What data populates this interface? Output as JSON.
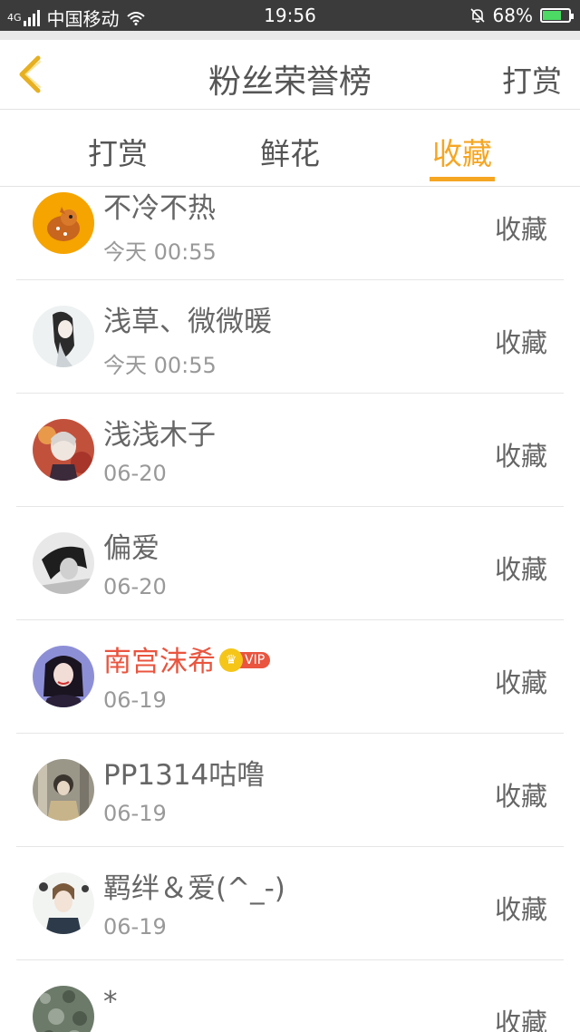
{
  "status_bar": {
    "network": "4G",
    "carrier": "中国移动",
    "time": "19:56",
    "battery": "68%"
  },
  "header": {
    "title": "粉丝荣誉榜",
    "right_action": "打赏"
  },
  "tabs": [
    {
      "label": "打赏",
      "active": false
    },
    {
      "label": "鲜花",
      "active": false
    },
    {
      "label": "收藏",
      "active": true
    }
  ],
  "colors": {
    "accent": "#f5a623",
    "vip_name": "#e9553f",
    "statusbar": "#3b3b3b"
  },
  "list": [
    {
      "name": "不冷不热",
      "time": "今天 00:55",
      "action": "收藏",
      "vip": false
    },
    {
      "name": "浅草、微微暖",
      "time": "今天 00:55",
      "action": "收藏",
      "vip": false
    },
    {
      "name": "浅浅木子",
      "time": "06-20",
      "action": "收藏",
      "vip": false
    },
    {
      "name": "偏爱",
      "time": "06-20",
      "action": "收藏",
      "vip": false
    },
    {
      "name": "南宫沫希",
      "time": "06-19",
      "action": "收藏",
      "vip": true,
      "badge": "VIP"
    },
    {
      "name": "PP1314咕噜",
      "time": "06-19",
      "action": "收藏",
      "vip": false
    },
    {
      "name": "羁绊＆爱(^_-)",
      "time": "06-19",
      "action": "收藏",
      "vip": false
    },
    {
      "name": "*",
      "time": "",
      "action": "收藏",
      "vip": false
    }
  ]
}
